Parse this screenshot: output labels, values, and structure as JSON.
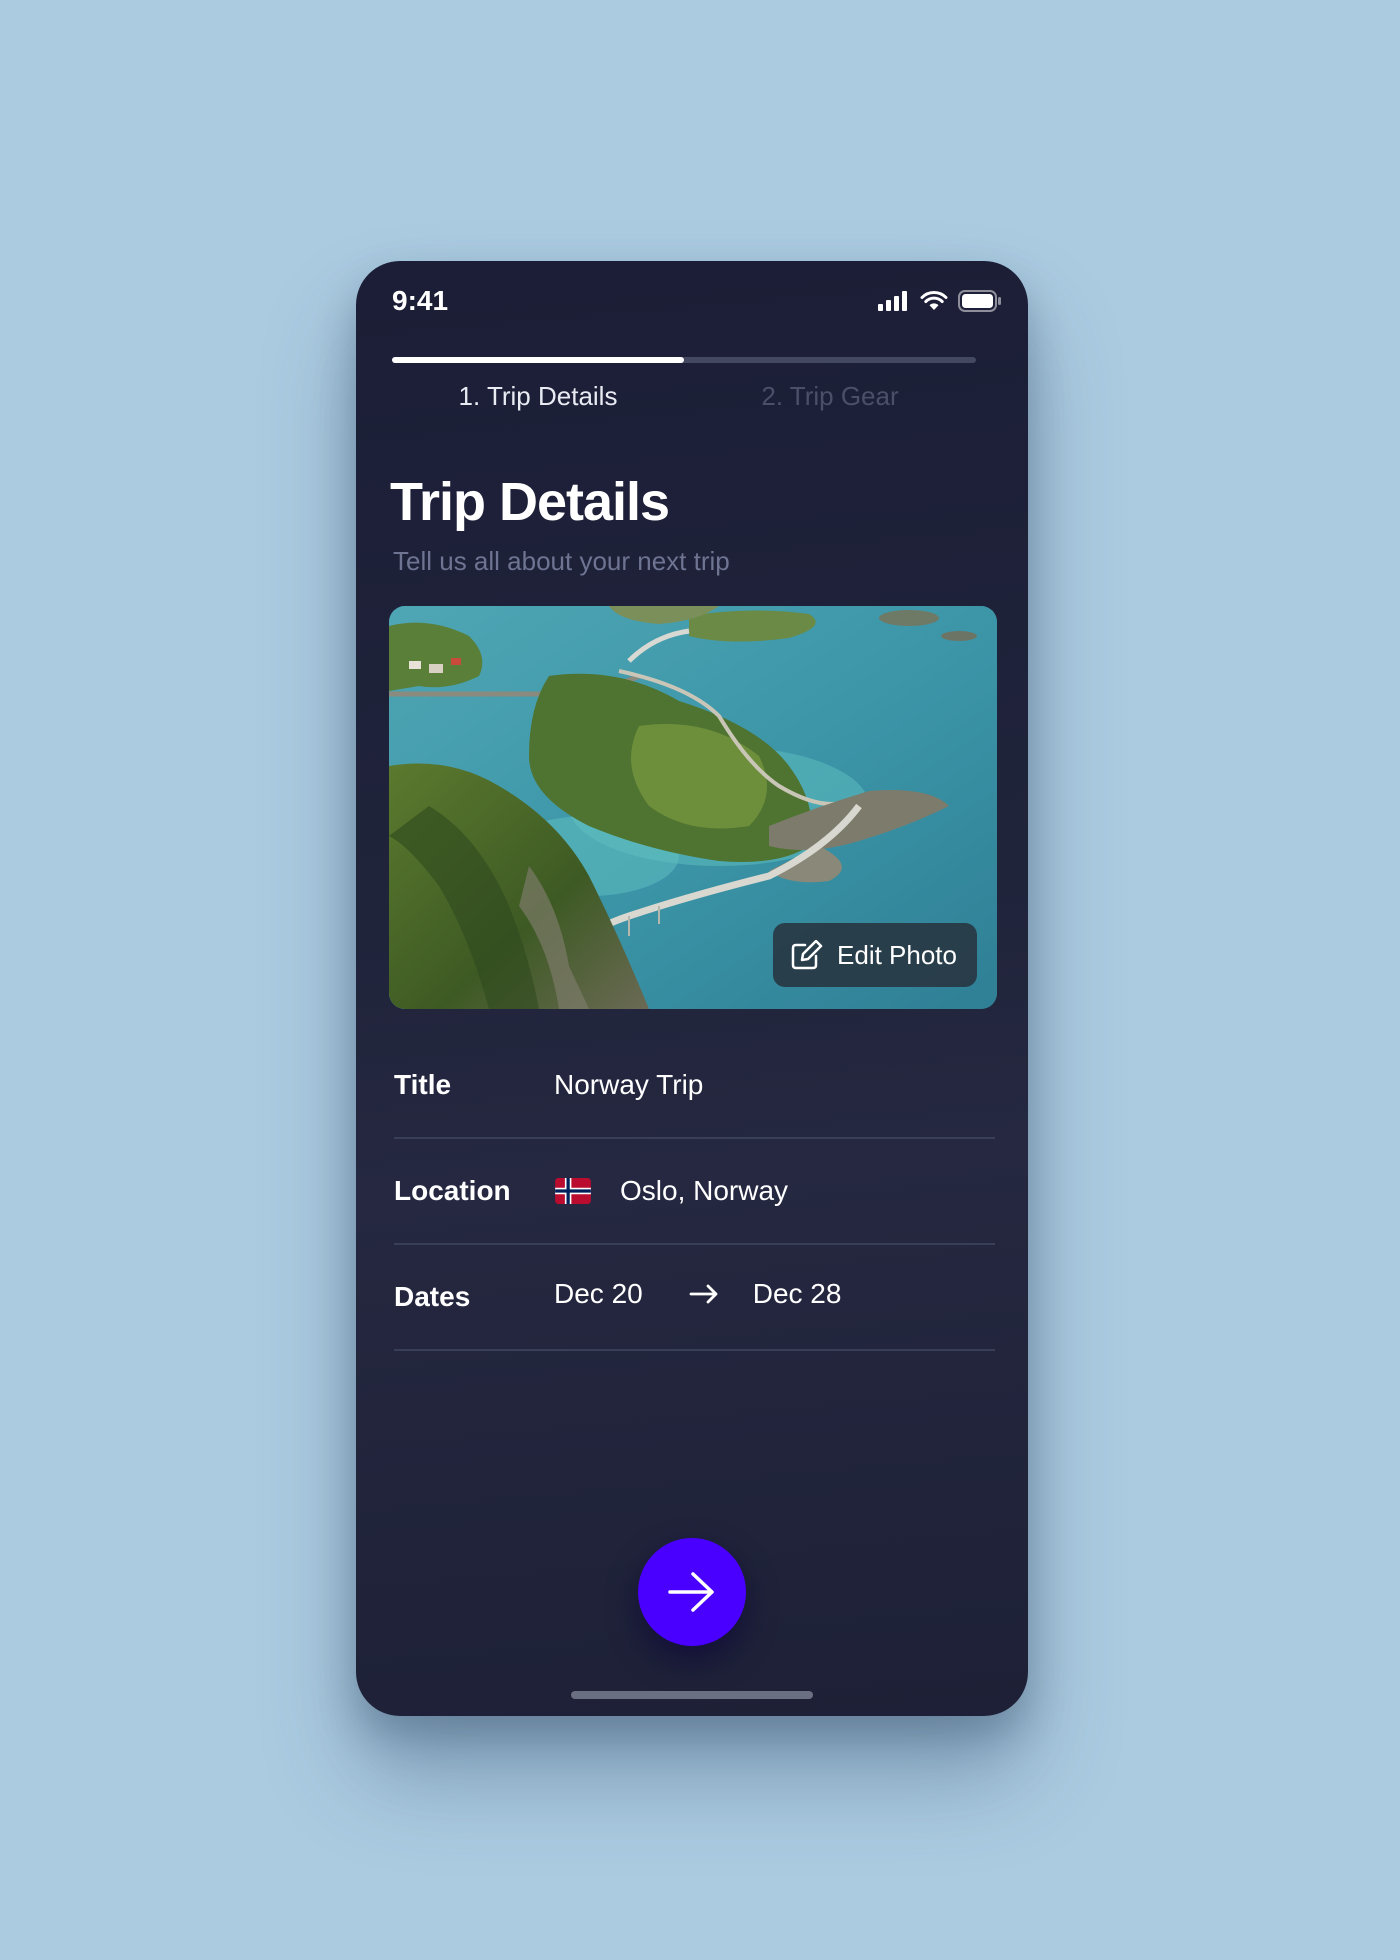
{
  "status_bar": {
    "time": "9:41",
    "icons": [
      "cellular-signal-icon",
      "wifi-icon",
      "battery-icon"
    ]
  },
  "stepper": {
    "progress": 0.5,
    "steps": [
      {
        "label": "1. Trip Details",
        "active": true
      },
      {
        "label": "2. Trip Gear",
        "active": false
      }
    ]
  },
  "header": {
    "title": "Trip Details",
    "subtitle": "Tell us all about your next trip"
  },
  "photo": {
    "edit_label": "Edit Photo",
    "edit_icon": "edit-pencil-icon"
  },
  "form": {
    "title": {
      "label": "Title",
      "value": "Norway Trip"
    },
    "location": {
      "label": "Location",
      "flag_icon": "norway-flag-icon",
      "value": "Oslo, Norway"
    },
    "dates": {
      "label": "Dates",
      "start": "Dec 20",
      "end": "Dec 28",
      "separator_icon": "arrow-right-icon"
    }
  },
  "next_button": {
    "icon": "arrow-right-icon"
  },
  "colors": {
    "background": "#abcbe1",
    "phone": "#1e2138",
    "accent": "#4a00ff",
    "subtitle": "#6e7491",
    "inactive_step": "#4b5068",
    "divider": "#3a3f58"
  }
}
